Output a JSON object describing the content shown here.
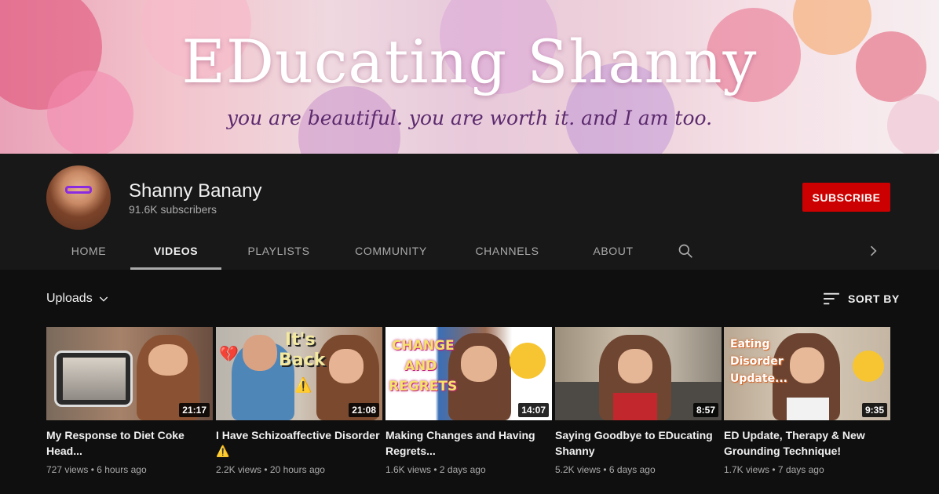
{
  "banner": {
    "title": "EDucating Shanny",
    "subtitle": "you are beautiful. you are worth it. and I am too."
  },
  "channel": {
    "name": "Shanny Banany",
    "subscribers": "91.6K subscribers",
    "subscribe_label": "SUBSCRIBE"
  },
  "tabs": [
    {
      "label": "HOME",
      "active": false
    },
    {
      "label": "VIDEOS",
      "active": true
    },
    {
      "label": "PLAYLISTS",
      "active": false
    },
    {
      "label": "COMMUNITY",
      "active": false
    },
    {
      "label": "CHANNELS",
      "active": false
    },
    {
      "label": "ABOUT",
      "active": false
    }
  ],
  "icons": {
    "search": "search-icon",
    "next": "chevron-right-icon",
    "sort": "sort-icon",
    "dropdown": "chevron-down-icon"
  },
  "uploads_label": "Uploads",
  "sort_label": "SORT BY",
  "videos": [
    {
      "title": "My Response to Diet Coke Head...",
      "views": "727 views",
      "age": "6 hours ago",
      "duration": "21:17"
    },
    {
      "title": "I Have Schizoaffective Disorder ⚠️",
      "views": "2.2K views",
      "age": "20 hours ago",
      "duration": "21:08",
      "thumb_text": [
        "It's",
        "Back"
      ]
    },
    {
      "title": "Making Changes and Having Regrets...",
      "views": "1.6K views",
      "age": "2 days ago",
      "duration": "14:07",
      "thumb_text": [
        "CHANGE",
        "AND",
        "REGRETS"
      ]
    },
    {
      "title": "Saying Goodbye to EDucating Shanny",
      "views": "5.2K views",
      "age": "6 days ago",
      "duration": "8:57"
    },
    {
      "title": "ED Update, Therapy & New Grounding Technique!",
      "views": "1.7K views",
      "age": "7 days ago",
      "duration": "9:35",
      "thumb_text": [
        "Eating",
        "Disorder",
        "Update..."
      ]
    }
  ],
  "meta_separator": " • ",
  "colors": {
    "background": "#0f0f0f",
    "header": "#181818",
    "subscribe": "#cc0000",
    "text": "#f1f1f1",
    "muted": "#aaaaaa"
  }
}
